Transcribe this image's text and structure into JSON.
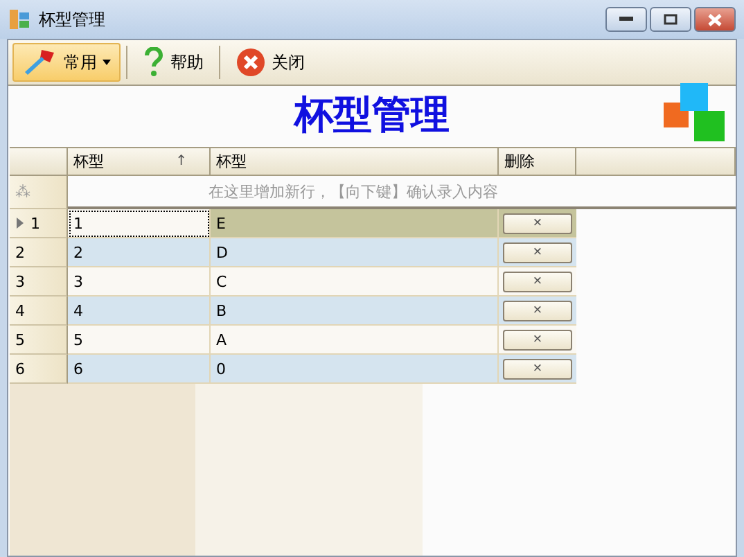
{
  "window": {
    "title": "杯型管理"
  },
  "toolbar": [
    {
      "kind": "dropdown",
      "label": "常用"
    },
    {
      "kind": "help",
      "label": "帮助"
    },
    {
      "kind": "close",
      "label": "关闭"
    }
  ],
  "heading": "杯型管理",
  "table": {
    "columns": [
      "杯型",
      "杯型",
      "删除"
    ],
    "sort_mark": "↑",
    "new_row_marker": "⁂",
    "new_row_hint": "在这里增加新行，【向下键】确认录入内容",
    "rows": [
      {
        "number": "1",
        "cells": [
          "1",
          "E"
        ],
        "delete": "×",
        "selected": true
      },
      {
        "number": "2",
        "cells": [
          "2",
          "D"
        ],
        "delete": "×",
        "selected": false
      },
      {
        "number": "3",
        "cells": [
          "3",
          "C"
        ],
        "delete": "×",
        "selected": false
      },
      {
        "number": "4",
        "cells": [
          "4",
          "B"
        ],
        "delete": "×",
        "selected": false
      },
      {
        "number": "5",
        "cells": [
          "5",
          "A"
        ],
        "delete": "×",
        "selected": false
      },
      {
        "number": "6",
        "cells": [
          "6",
          "0"
        ],
        "delete": "×",
        "selected": false
      }
    ]
  }
}
